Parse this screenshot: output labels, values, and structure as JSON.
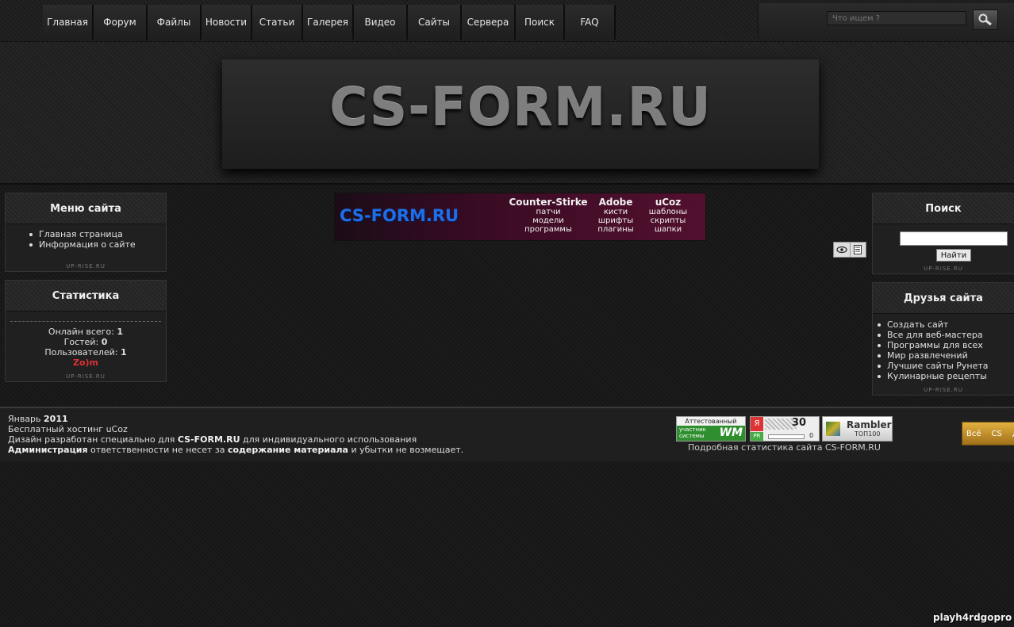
{
  "nav": {
    "items": [
      "Главная",
      "Форум",
      "Файлы",
      "Новости",
      "Статьи",
      "Галерея",
      "Видео",
      "Сайты",
      "Сервера",
      "Поиск",
      "FAQ"
    ]
  },
  "top_search": {
    "placeholder": "Что ищем ?"
  },
  "header": {
    "logo": "CS-FORM.RU"
  },
  "menu_block": {
    "title": "Меню сайта",
    "items": [
      "Главная страница",
      "Информация о сайте"
    ],
    "credit": "UP-RISE.RU"
  },
  "stats_block": {
    "title": "Статистика",
    "online_label": "Онлайн всего:",
    "online_value": "1",
    "guests_label": "Гостей:",
    "guests_value": "0",
    "users_label": "Пользователей:",
    "users_value": "1",
    "user_name": "Zo)m",
    "credit": "UP-RISE.RU"
  },
  "banner": {
    "logo": "CS-FORM.RU",
    "columns": [
      {
        "head": "Counter-Stirke",
        "lines": [
          "патчи",
          "модели",
          "программы"
        ]
      },
      {
        "head": "Adobe",
        "lines": [
          "кисти",
          "шрифты",
          "плагины"
        ]
      },
      {
        "head": "uCoz",
        "lines": [
          "шаблоны",
          "скрипты",
          "шапки"
        ]
      }
    ]
  },
  "search_block": {
    "title": "Поиск",
    "button": "Найти",
    "credit": "UP-RISE.RU"
  },
  "friends_block": {
    "title": "Друзья сайта",
    "items": [
      "Создать сайт",
      "Все для веб-мастера",
      "Программы для всех",
      "Мир развлечений",
      "Лучшие сайты Рунета",
      "Кулинарные рецепты"
    ],
    "credit": "UP-RISE.RU"
  },
  "footer": {
    "date_prefix": "Январь ",
    "year": "2011",
    "hosting": "Бесплатный хостинг uCoz",
    "design_prefix": "Дизайн разработан специально для ",
    "design_site": "CS-FORM.RU",
    "design_suffix": " для индивидуального использования",
    "admin_bold": "Администрация",
    "admin_mid": " ответственности не несет за ",
    "admin_bold2": "содержание материала",
    "admin_suffix": " и убытки не возмещает.",
    "stats_link": "Подробная статистика сайта CS-FORM.RU",
    "wm_line1": "Аттестованный",
    "wm_line2": "участник",
    "wm_line3": "системы",
    "wm_logo": "WM",
    "ya_letter": "Я",
    "ya_value": "30",
    "ya_pr": "PR",
    "ya_pr_value": "0",
    "rambler_line1": "Rambler",
    "rambler_line2": "ТОП100",
    "side_widget": [
      "Всё",
      "CS",
      "Д"
    ]
  },
  "watermark": "playh4rdgopro"
}
